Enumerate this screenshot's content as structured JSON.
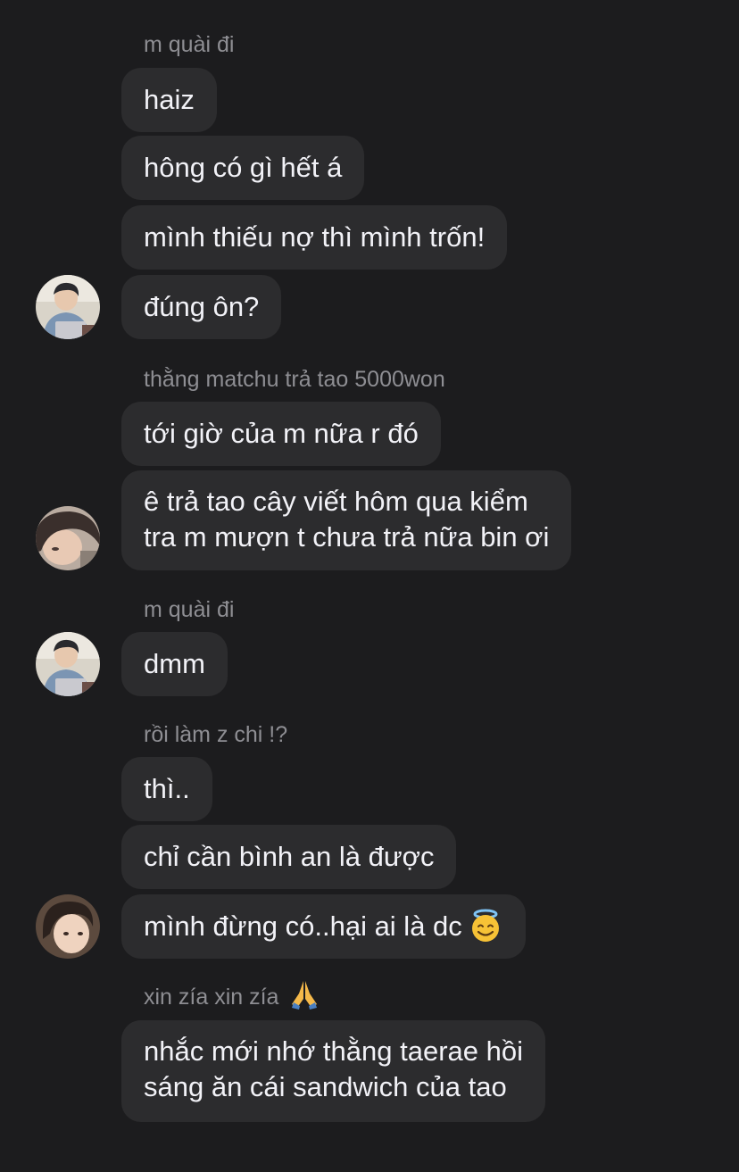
{
  "messages": [
    {
      "reply_to": "m quài đi",
      "text": "haiz"
    },
    {
      "text": "hông có gì hết á"
    },
    {
      "text": "mình thiếu nợ thì mình trốn!"
    },
    {
      "text": "đúng ôn?"
    },
    {
      "reply_to": "thằng matchu trả tao 5000won",
      "text": "tới giờ của m nữa r đó"
    },
    {
      "text_line1": "ê trả tao cây viết hôm qua kiểm",
      "text_line2": "tra m mượn t chưa trả nữa bin ơi"
    },
    {
      "reply_to": "m quài đi",
      "text": "dmm"
    },
    {
      "reply_to": "rồi làm z chi !?",
      "text": "thì.."
    },
    {
      "text": "chỉ cần bình an là được"
    },
    {
      "text": "mình đừng có..hại ai là dc",
      "emoji": "smiling-face-with-halo-icon"
    },
    {
      "reply_to": "xin zía xin zía",
      "reply_emoji": "folded-hands-icon",
      "text_line1": "nhắc mới nhớ thằng taerae hồi",
      "text_line2": "sáng ăn cái sandwich của tao"
    }
  ],
  "colors": {
    "background": "#1c1c1e",
    "bubble": "#2c2c2e",
    "text": "#f2f2f7",
    "reply_text": "#8e8e93"
  }
}
